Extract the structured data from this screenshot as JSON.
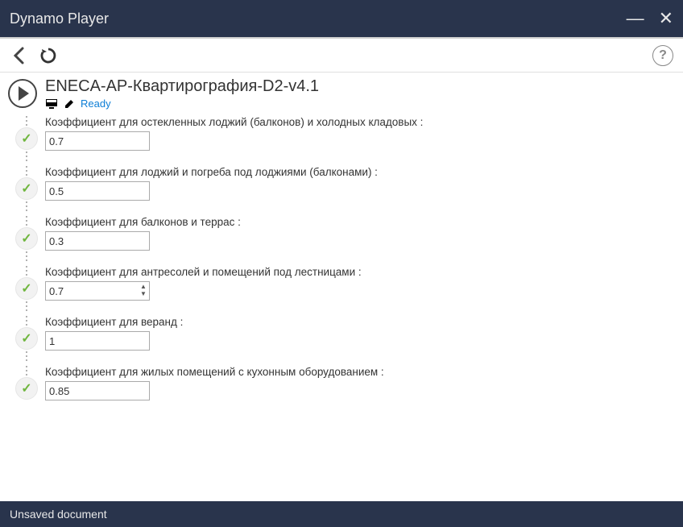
{
  "window": {
    "title": "Dynamo Player"
  },
  "script": {
    "name": "ENECA-AP-Квартирография-D2-v4.1",
    "status": "Ready"
  },
  "params": [
    {
      "label": "Коэффициент для остекленных лоджий (балконов) и холодных кладовых :",
      "value": "0.7",
      "type": "text"
    },
    {
      "label": "Коэффициент для лоджий и погреба под лоджиями (балконами) :",
      "value": "0.5",
      "type": "text"
    },
    {
      "label": "Коэффициент для балконов и террас :",
      "value": "0.3",
      "type": "text"
    },
    {
      "label": "Коэффициент для антресолей и помещений под лестницами :",
      "value": "0.7",
      "type": "number"
    },
    {
      "label": "Коэффициент для веранд :",
      "value": "1",
      "type": "text"
    },
    {
      "label": "Коэффициент для жилых помещений с кухонным оборудованием :",
      "value": "0.85",
      "type": "text"
    }
  ],
  "statusbar": {
    "text": "Unsaved document"
  }
}
